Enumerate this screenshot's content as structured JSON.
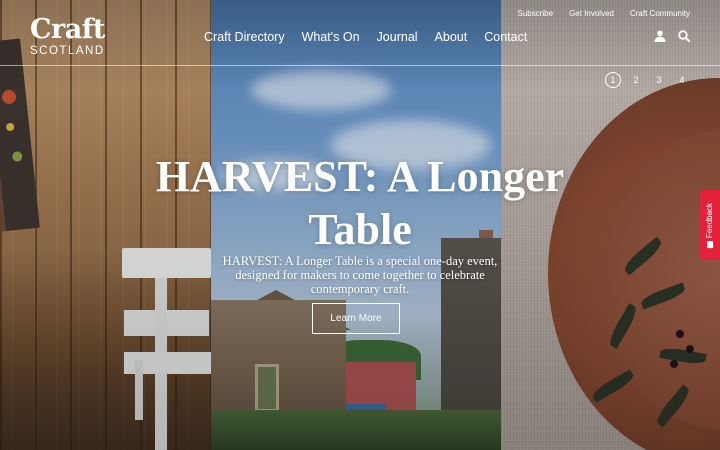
{
  "brand": {
    "word": "Craft",
    "sub": "SCOTLAND"
  },
  "utility_nav": [
    {
      "label": "Subscribe"
    },
    {
      "label": "Get Involved"
    },
    {
      "label": "Craft Community"
    }
  ],
  "main_nav": [
    {
      "label": "Craft Directory"
    },
    {
      "label": "What's On"
    },
    {
      "label": "Journal"
    },
    {
      "label": "About"
    },
    {
      "label": "Contact"
    }
  ],
  "icons": {
    "account": "user-icon",
    "search": "search-icon"
  },
  "slider": {
    "pages": [
      "1",
      "2",
      "3",
      "4"
    ],
    "active_index": 0
  },
  "hero": {
    "title_line1": "HARVEST: A Longer",
    "title_line2": "Table",
    "description": "HARVEST: A Longer Table is a special one-day event, designed for makers to come together to celebrate contemporary craft.",
    "cta_label": "Learn More"
  },
  "feedback": {
    "label": "Feedback",
    "color": "#e2223b"
  }
}
